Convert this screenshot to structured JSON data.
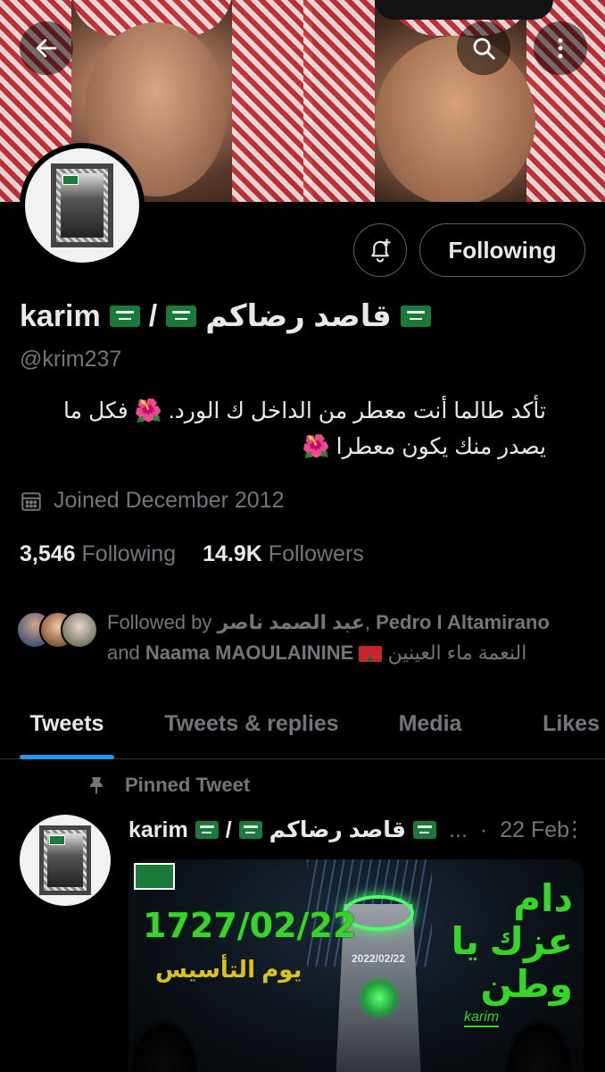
{
  "header": {
    "back_icon": "arrow-left-icon",
    "search_icon": "search-icon",
    "more_icon": "more-vertical-icon"
  },
  "profile": {
    "name_latin": "karim",
    "name_sep": "/",
    "name_arabic": "قاصد رضاكم",
    "handle": "@krim237",
    "bio": "تأكد طالما أنت معطر من الداخل ك الورد. 🌺 فكل ما يصدر منك يكون معطرا 🌺",
    "joined": "Joined December 2012",
    "following_count": "3,546",
    "following_label": "Following",
    "followers_count": "14.9K",
    "followers_label": "Followers"
  },
  "actions": {
    "follow_state": "Following"
  },
  "followed_by": {
    "prefix": "Followed by",
    "name1": "عبد الصمد ناصر",
    "name2": "Pedro I Altamirano",
    "conj": "and",
    "name3": "Naama MAOULAININE",
    "name3_ar": "النعمة ماء العينين"
  },
  "tabs": [
    {
      "label": "Tweets",
      "active": true
    },
    {
      "label": "Tweets & replies",
      "active": false
    },
    {
      "label": "Media",
      "active": false
    },
    {
      "label": "Likes",
      "active": false
    }
  ],
  "pinned": {
    "label": "Pinned Tweet",
    "author_latin": "karim",
    "author_sep": "/",
    "author_arabic": "قاصد رضاكم",
    "ellipsis": "...",
    "dot": "·",
    "date": "22 Feb",
    "more": "⋮",
    "media": {
      "big_date": "1727/02/22",
      "sub": "يوم التأسيس",
      "tower_date": "2022/02/22",
      "right_text": "دام عزك يا وطن",
      "signature": "karim"
    }
  },
  "colors": {
    "accent": "#1d9bf0",
    "muted": "#71767b",
    "text": "#e7e9ea",
    "bg": "#000000"
  }
}
